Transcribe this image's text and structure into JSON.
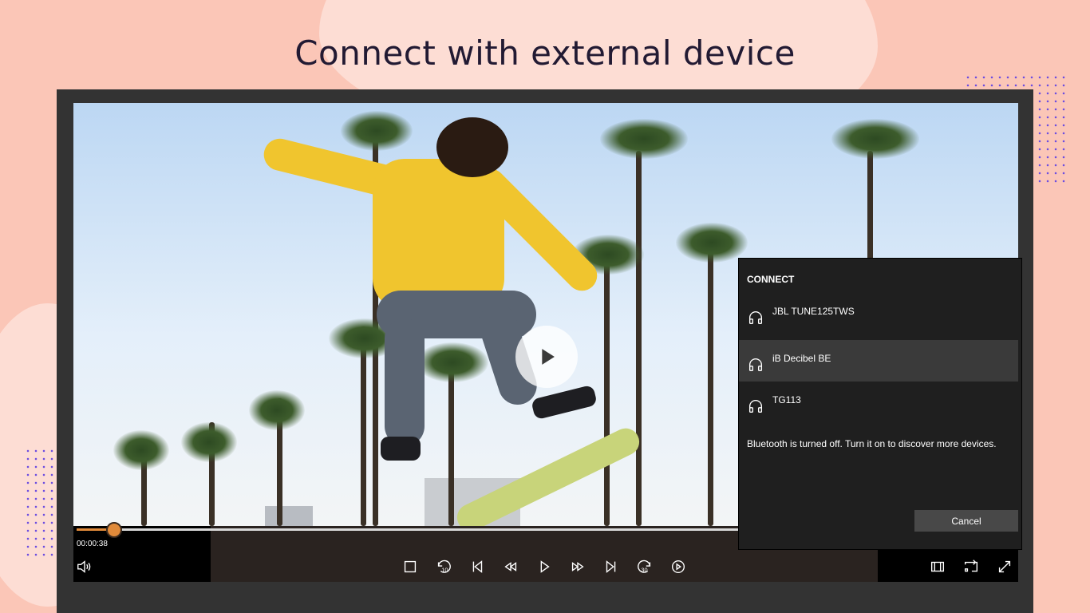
{
  "headline": "Connect with external device",
  "player": {
    "current_time": "00:00:38",
    "progress_fraction": 0.057
  },
  "controls": {
    "left": [
      {
        "name": "volume-icon"
      }
    ],
    "center": [
      {
        "name": "stop-icon"
      },
      {
        "name": "rewind-10-icon",
        "badge": "10"
      },
      {
        "name": "previous-icon"
      },
      {
        "name": "fast-rewind-icon"
      },
      {
        "name": "play-icon"
      },
      {
        "name": "fast-forward-icon"
      },
      {
        "name": "next-icon"
      },
      {
        "name": "forward-30-icon",
        "badge": "30"
      },
      {
        "name": "playback-speed-icon"
      }
    ],
    "right": [
      {
        "name": "aspect-ratio-icon"
      },
      {
        "name": "cast-icon"
      },
      {
        "name": "fullscreen-icon"
      }
    ]
  },
  "connect_panel": {
    "title": "CONNECT",
    "devices": [
      {
        "name": "JBL TUNE125TWS",
        "icon": "headphones-icon",
        "selected": false
      },
      {
        "name": "iB Decibel BE",
        "icon": "headphones-icon",
        "selected": true
      },
      {
        "name": "TG113",
        "icon": "headphones-icon",
        "selected": false
      }
    ],
    "bluetooth_message": "Bluetooth is turned off. Turn it on to discover more devices.",
    "cancel_label": "Cancel"
  },
  "colors": {
    "background": "#fbc6b7",
    "accent": "#e08a3a",
    "panel": "#1f1f1f",
    "selected_row": "#3a3a3a",
    "dots": "#6d4ee0"
  }
}
